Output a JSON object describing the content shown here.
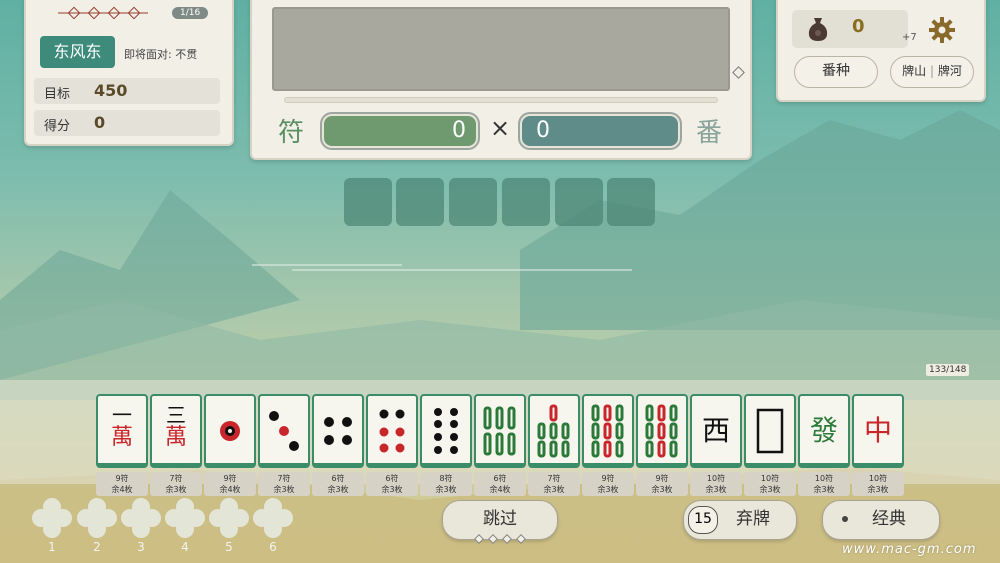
{
  "hud": {
    "round_progress": "1/16",
    "wind": "东风东",
    "facing_text": "即将面对: 不贯",
    "target_label": "目标",
    "target_value": "450",
    "score_label": "得分",
    "score_value": "0"
  },
  "scoring": {
    "fu_label": "符",
    "fu_value": "0",
    "times": "×",
    "fan_value": "0",
    "fan_label": "番"
  },
  "top_right": {
    "coins": "0",
    "coin_bonus": "+7",
    "fanzhong_label": "番种",
    "pile_label_a": "牌山",
    "pile_label_b": "牌河"
  },
  "wall_count": "133/148",
  "hand_tiles": [
    {
      "face": "一萬",
      "fu": "9符",
      "remain": "余4枚"
    },
    {
      "face": "三萬",
      "fu": "7符",
      "remain": "余3枚"
    },
    {
      "face": "1p",
      "fu": "9符",
      "remain": "余4枚"
    },
    {
      "face": "3p",
      "fu": "7符",
      "remain": "余3枚"
    },
    {
      "face": "4p",
      "fu": "6符",
      "remain": "余3枚"
    },
    {
      "face": "6p",
      "fu": "6符",
      "remain": "余3枚"
    },
    {
      "face": "8p",
      "fu": "8符",
      "remain": "余3枚"
    },
    {
      "face": "6s",
      "fu": "6符",
      "remain": "余4枚"
    },
    {
      "face": "7s",
      "fu": "7符",
      "remain": "余3枚"
    },
    {
      "face": "9s-a",
      "fu": "9符",
      "remain": "余3枚"
    },
    {
      "face": "9s-b",
      "fu": "9符",
      "remain": "余3枚"
    },
    {
      "face": "西",
      "fu": "10符",
      "remain": "余3枚"
    },
    {
      "face": "白",
      "fu": "10符",
      "remain": "余3枚"
    },
    {
      "face": "發",
      "fu": "10符",
      "remain": "余3枚"
    },
    {
      "face": "中",
      "fu": "10符",
      "remain": "余3枚"
    }
  ],
  "flower_slots": [
    "1",
    "2",
    "3",
    "4",
    "5",
    "6"
  ],
  "actions": {
    "skip": "跳过",
    "discard_count": "15",
    "discard": "弃牌",
    "mode": "经典"
  },
  "watermark": "www.mac-gm.com",
  "colors": {
    "tile_border": "#3b8d6a",
    "man_red": "#c8262b",
    "sou_green": "#2b7a3a",
    "accent_teal": "#3e8b7c"
  }
}
